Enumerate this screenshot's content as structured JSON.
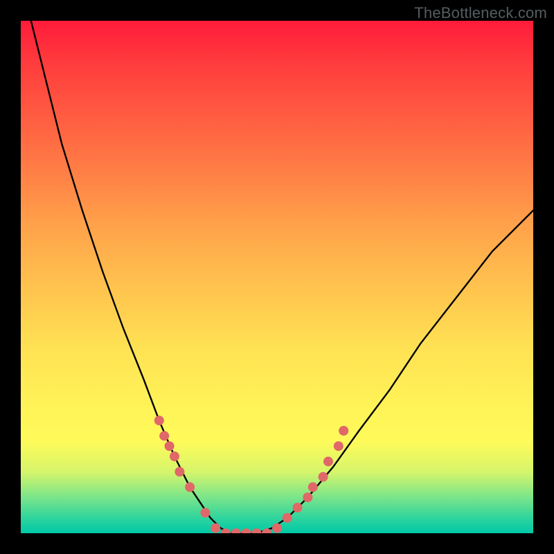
{
  "attribution": "TheBottleneck.com",
  "chart_data": {
    "type": "line",
    "title": "",
    "xlabel": "",
    "ylabel": "",
    "xlim": [
      0,
      100
    ],
    "ylim": [
      0,
      100
    ],
    "grid": false,
    "legend": false,
    "series": [
      {
        "name": "curve",
        "x": [
          2,
          5,
          8,
          12,
          16,
          20,
          24,
          27,
          30,
          33,
          35,
          37,
          39,
          41,
          43,
          46,
          49,
          52,
          56,
          61,
          66,
          72,
          78,
          85,
          92,
          100
        ],
        "y": [
          100,
          88,
          76,
          63,
          51,
          40,
          30,
          22,
          15,
          9,
          6,
          3,
          1,
          0,
          0,
          0,
          1,
          3,
          7,
          13,
          20,
          28,
          37,
          46,
          55,
          63
        ]
      }
    ],
    "markers": {
      "name": "highlight-points",
      "color": "#e06868",
      "radius_px": 7,
      "points": [
        {
          "x": 27,
          "y": 22
        },
        {
          "x": 28,
          "y": 19
        },
        {
          "x": 29,
          "y": 17
        },
        {
          "x": 30,
          "y": 15
        },
        {
          "x": 31,
          "y": 12
        },
        {
          "x": 33,
          "y": 9
        },
        {
          "x": 36,
          "y": 4
        },
        {
          "x": 38,
          "y": 1
        },
        {
          "x": 40,
          "y": 0
        },
        {
          "x": 42,
          "y": 0
        },
        {
          "x": 44,
          "y": 0
        },
        {
          "x": 46,
          "y": 0
        },
        {
          "x": 48,
          "y": 0
        },
        {
          "x": 50,
          "y": 1
        },
        {
          "x": 52,
          "y": 3
        },
        {
          "x": 54,
          "y": 5
        },
        {
          "x": 56,
          "y": 7
        },
        {
          "x": 57,
          "y": 9
        },
        {
          "x": 59,
          "y": 11
        },
        {
          "x": 60,
          "y": 14
        },
        {
          "x": 62,
          "y": 17
        },
        {
          "x": 63,
          "y": 20
        }
      ]
    },
    "background_gradient": {
      "direction": "vertical",
      "stops": [
        {
          "pos": 0.0,
          "color": "#ff1b3a"
        },
        {
          "pos": 0.4,
          "color": "#ffa24a"
        },
        {
          "pos": 0.74,
          "color": "#fff157"
        },
        {
          "pos": 1.0,
          "color": "#00c9a7"
        }
      ]
    },
    "frame_color": "#000000"
  }
}
